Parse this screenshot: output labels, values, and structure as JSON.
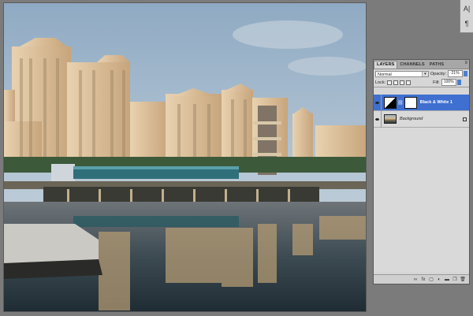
{
  "app": {
    "canvas_background": "#7b7b7b",
    "accent": "#3f6fd0"
  },
  "mini_tools": {
    "items": [
      {
        "glyph": "A|",
        "icon": "character-icon"
      },
      {
        "glyph": "¶",
        "icon": "paragraph-icon"
      }
    ]
  },
  "layers_panel": {
    "tabs": [
      {
        "label": "LAYERS",
        "active": true
      },
      {
        "label": "CHANNELS",
        "active": false
      },
      {
        "label": "PATHS",
        "active": false
      }
    ],
    "menu_glyph": "≡",
    "blend_mode": "Normal",
    "opacity_label": "Opacity:",
    "opacity_value": "21%",
    "lock_label": "Lock:",
    "fill_label": "Fill:",
    "fill_value": "100%",
    "layers": [
      {
        "name": "Black & White 1",
        "type": "adjustment",
        "selected": true,
        "visible": true
      },
      {
        "name": "Background",
        "type": "image",
        "selected": false,
        "visible": true,
        "locked": true
      }
    ],
    "footer_icons": [
      {
        "glyph": "∞",
        "icon": "link-layers-icon"
      },
      {
        "glyph": "fx",
        "icon": "layer-style-icon"
      },
      {
        "glyph": "▢",
        "icon": "add-mask-icon"
      },
      {
        "glyph": "◐",
        "icon": "new-adjustment-icon"
      },
      {
        "glyph": "▬",
        "icon": "new-group-icon"
      },
      {
        "glyph": "❐",
        "icon": "new-layer-icon"
      },
      {
        "glyph": "🗑",
        "icon": "trash-icon"
      }
    ]
  }
}
